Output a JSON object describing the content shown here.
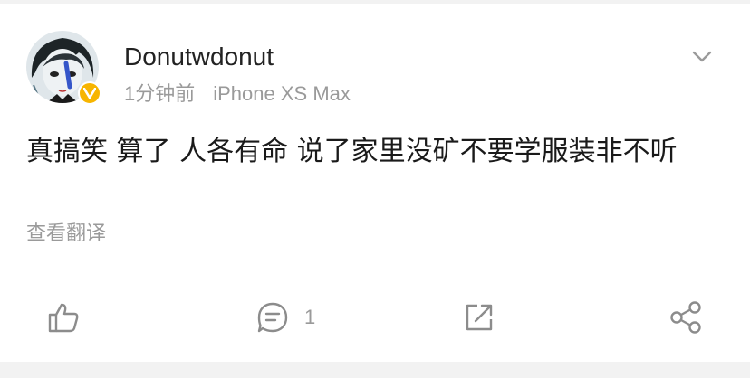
{
  "post": {
    "username": "Donutwdonut",
    "time": "1分钟前",
    "device": "iPhone XS Max",
    "content": "真搞笑 算了 人各有命 说了家里没矿不要学服装非不听",
    "translate_label": "查看翻译"
  },
  "actions": {
    "like_icon": "thumbs-up-icon",
    "comment_icon": "comment-icon",
    "comment_count": "1",
    "repost_icon": "share-out-icon",
    "share_icon": "share-icon"
  },
  "colors": {
    "badge": "#f7b500",
    "icon": "#8c8c8c",
    "secondary_text": "#9a9a9a",
    "background": "#f2f2f2"
  }
}
